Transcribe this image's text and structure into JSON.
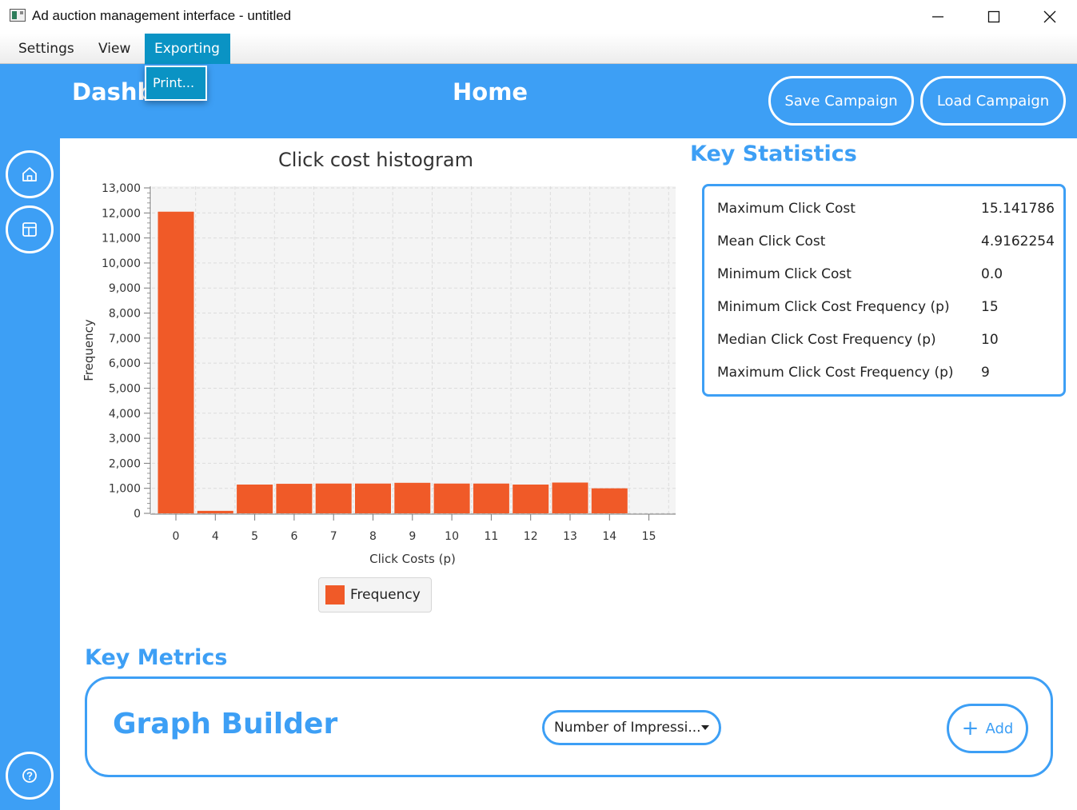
{
  "window": {
    "title": "Ad auction management interface - untitled"
  },
  "menubar": {
    "items": [
      {
        "label": "Settings"
      },
      {
        "label": "View"
      },
      {
        "label": "Exporting"
      }
    ],
    "dropdown": {
      "items": [
        {
          "label": "Print..."
        }
      ]
    }
  },
  "header": {
    "dashboard_title": "Dashb",
    "page_title": "Home",
    "save_label": "Save Campaign",
    "load_label": "Load Campaign"
  },
  "sidebar": {
    "items": [
      {
        "icon": "home-icon"
      },
      {
        "icon": "layout-icon"
      },
      {
        "icon": "help-icon"
      }
    ]
  },
  "chart_data": {
    "type": "bar",
    "title": "Click cost histogram",
    "xlabel": "Click Costs (p)",
    "ylabel": "Frequency",
    "categories": [
      "0",
      "4",
      "5",
      "6",
      "7",
      "8",
      "9",
      "10",
      "11",
      "12",
      "13",
      "14",
      "15"
    ],
    "series": [
      {
        "name": "Frequency",
        "values": [
          12050,
          100,
          1150,
          1180,
          1190,
          1190,
          1220,
          1190,
          1190,
          1150,
          1230,
          1000,
          0
        ],
        "color": "#f05a28"
      }
    ],
    "ylim": [
      0,
      13000
    ],
    "yticks": [
      "0",
      "1,000",
      "2,000",
      "3,000",
      "4,000",
      "5,000",
      "6,000",
      "7,000",
      "8,000",
      "9,000",
      "10,000",
      "11,000",
      "12,000",
      "13,000"
    ],
    "grid": true,
    "legend": "bottom"
  },
  "statistics": {
    "heading": "Key Statistics",
    "rows": [
      {
        "label": "Maximum Click Cost",
        "value": "15.141786"
      },
      {
        "label": "Mean Click Cost",
        "value": "4.9162254"
      },
      {
        "label": "Minimum Click Cost",
        "value": "0.0"
      },
      {
        "label": "Minimum Click Cost Frequency (p)",
        "value": "15"
      },
      {
        "label": "Median Click Cost Frequency (p)",
        "value": "10"
      },
      {
        "label": "Maximum Click Cost Frequency (p)",
        "value": "9"
      }
    ]
  },
  "metrics": {
    "heading": "Key Metrics",
    "graph_builder_title": "Graph Builder",
    "selected_metric": "Number of Impressi...",
    "add_label": "Add"
  },
  "colors": {
    "accent": "#3d9ff5",
    "menu_highlight": "#0a93c4",
    "bar": "#f05a28"
  }
}
